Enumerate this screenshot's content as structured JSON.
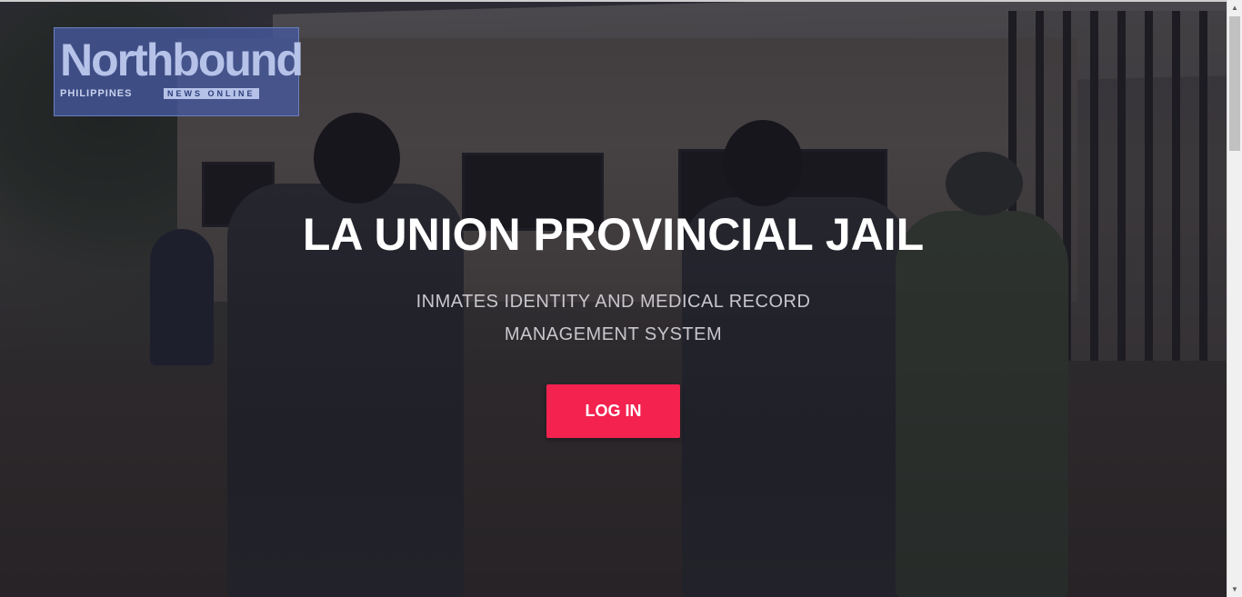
{
  "logo": {
    "main": "Northbound",
    "sub": "PHILIPPINES",
    "tag": "NEWS ONLINE"
  },
  "hero": {
    "title": "LA UNION PROVINCIAL JAIL",
    "subtitle_line1": "INMATES IDENTITY AND MEDICAL RECORD",
    "subtitle_line2": "MANAGEMENT SYSTEM",
    "login_label": "LOG IN"
  },
  "colors": {
    "accent": "#f3224f",
    "overlay": "#14121e"
  },
  "scrollbar": {
    "up_icon": "triangle-up",
    "down_icon": "triangle-down"
  }
}
